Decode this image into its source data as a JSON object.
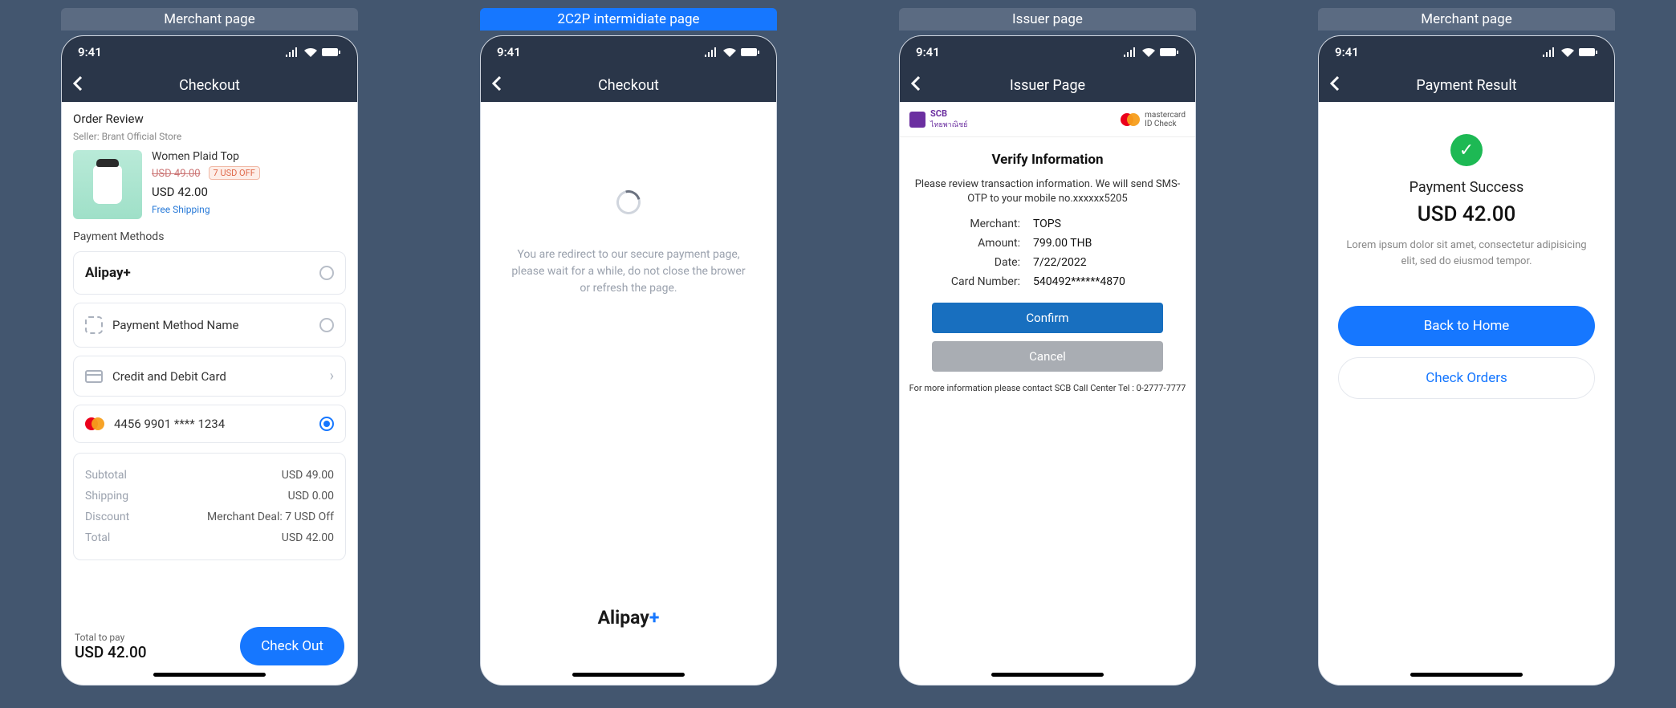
{
  "shared": {
    "time": "9:41"
  },
  "tags": [
    "Merchant page",
    "2C2P intermidiate page",
    "Issuer page",
    "Merchant page"
  ],
  "active_tag_index": 1,
  "screen1": {
    "nav_title": "Checkout",
    "order_review": "Order Review",
    "seller_label": "Seller: Brant Official Store",
    "product": {
      "name": "Women Plaid Top",
      "old_price": "USD 49.00",
      "discount_badge": "7 USD OFF",
      "price": "USD 42.00",
      "shipping": "Free Shipping"
    },
    "payment_methods_label": "Payment Methods",
    "methods": [
      {
        "name": "Alipay+",
        "selected": false,
        "type": "alipay"
      },
      {
        "name": "Payment Method Name",
        "selected": false,
        "type": "placeholder"
      },
      {
        "name": "Credit and Debit Card",
        "selected": false,
        "type": "card-group"
      },
      {
        "name": "4456 9901 **** 1234",
        "selected": true,
        "type": "mastercard"
      }
    ],
    "totals": {
      "subtotal_label": "Subtotal",
      "subtotal": "USD 49.00",
      "shipping_label": "Shipping",
      "shipping": "USD 0.00",
      "discount_label": "Discount",
      "discount": "Merchant Deal: 7 USD Off",
      "total_label": "Total",
      "total": "USD 42.00"
    },
    "footer": {
      "label": "Total to pay",
      "amount": "USD 42.00",
      "button": "Check Out"
    }
  },
  "screen2": {
    "nav_title": "Checkout",
    "message": "You are redirect to our secure payment page, please wait for a while, do not close the brower or refresh the page.",
    "footer_brand": "Alipay",
    "footer_plus": "+"
  },
  "screen3": {
    "nav_title": "Issuer Page",
    "bank_name": "SCB",
    "bank_sub": "ไทยพาณิชย์",
    "mc_brand": "mastercard",
    "mc_sub": "ID Check",
    "heading": "Verify Information",
    "description": "Please review transaction information. We will send SMS-OTP to your mobile no.xxxxxx5205",
    "fields": {
      "merchant_k": "Merchant:",
      "merchant_v": "TOPS",
      "amount_k": "Amount:",
      "amount_v": "799.00 THB",
      "date_k": "Date:",
      "date_v": "7/22/2022",
      "card_k": "Card Number:",
      "card_v": "540492******4870"
    },
    "confirm": "Confirm",
    "cancel": "Cancel",
    "more_info": "For more information please contact SCB Call Center Tel : 0-2777-7777"
  },
  "screen4": {
    "nav_title": "Payment Result",
    "status": "Payment Success",
    "amount": "USD 42.00",
    "desc": "Lorem ipsum dolor sit amet, consectetur adipisicing elit, sed do eiusmod tempor.",
    "home_btn": "Back to Home",
    "orders_btn": "Check Orders"
  }
}
